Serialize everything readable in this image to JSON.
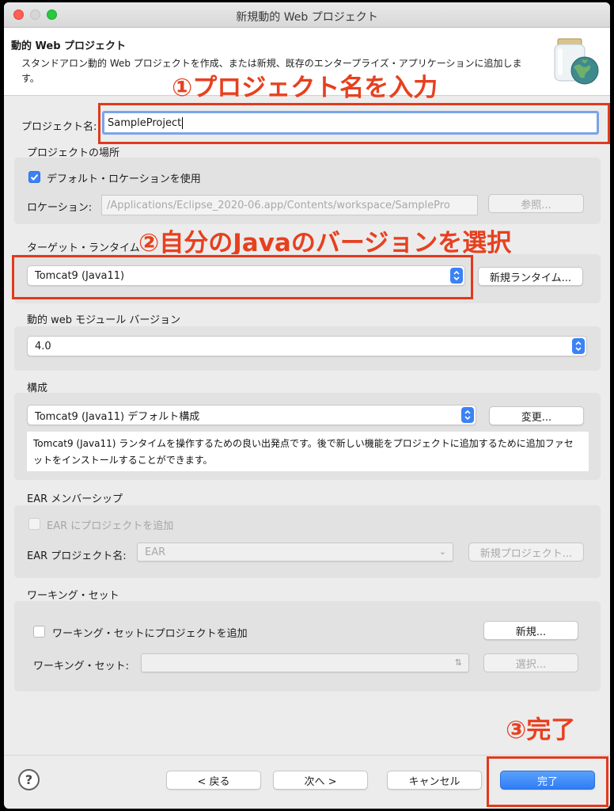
{
  "window": {
    "title": "新規動的 Web プロジェクト"
  },
  "header": {
    "title": "動的 Web プロジェクト",
    "description": "スタンドアロン動的 Web プロジェクトを作成、または新規、既存のエンタープライズ・アプリケーションに追加します。",
    "icon": "web-project-jar-globe-icon"
  },
  "annotations": {
    "step1": "①プロジェクト名を入力",
    "step2": "②自分のJavaのバージョンを選択",
    "step3": "③完了",
    "color": "#e7401f"
  },
  "project_name": {
    "label": "プロジェクト名:",
    "value": "SampleProject"
  },
  "location": {
    "group_label": "プロジェクトの場所",
    "use_default_label": "デフォルト・ロケーションを使用",
    "use_default_checked": true,
    "location_label": "ロケーション:",
    "location_value": "/Applications/Eclipse_2020-06.app/Contents/workspace/SamplePro",
    "browse_label": "参照..."
  },
  "target_runtime": {
    "label": "ターゲット・ランタイム",
    "selected": "Tomcat9 (Java11)",
    "new_runtime_label": "新規ランタイム..."
  },
  "module_version": {
    "label": "動的 web モジュール バージョン",
    "selected": "4.0"
  },
  "configuration": {
    "label": "構成",
    "selected": "Tomcat9 (Java11) デフォルト構成",
    "modify_label": "変更...",
    "description": "Tomcat9 (Java11) ランタイムを操作するための良い出発点です。後で新しい機能をプロジェクトに追加するために追加ファセットをインストールすることができます。"
  },
  "ear": {
    "group_label": "EAR メンバーシップ",
    "add_label": "EAR にプロジェクトを追加",
    "add_checked": false,
    "project_label": "EAR プロジェクト名:",
    "project_value": "EAR",
    "new_project_label": "新規プロジェクト..."
  },
  "working_set": {
    "group_label": "ワーキング・セット",
    "add_label": "ワーキング・セットにプロジェクトを追加",
    "add_checked": false,
    "new_label": "新規...",
    "set_label": "ワーキング・セット:",
    "select_label": "選択..."
  },
  "footer": {
    "help": "?",
    "back_label": "< 戻る",
    "next_label": "次へ >",
    "cancel_label": "キャンセル",
    "finish_label": "完了"
  }
}
